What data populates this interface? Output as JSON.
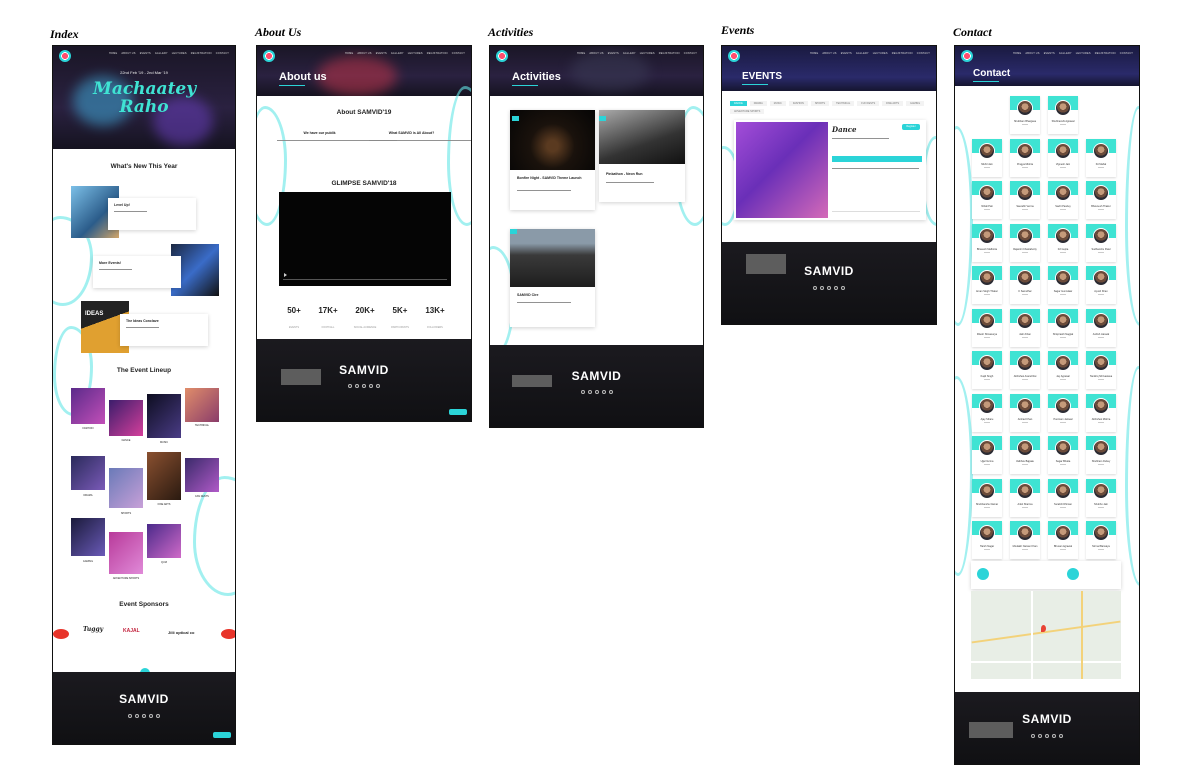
{
  "labels": {
    "index": "Index",
    "about": "About Us",
    "activities": "Activities",
    "events": "Events",
    "contact": "Contact"
  },
  "nav": [
    "HOME",
    "ABOUT US",
    "EVENTS",
    "GALLERY",
    "LECTURES",
    "REGISTRATION",
    "CONTACT"
  ],
  "index": {
    "hero_dates": "22nd Feb '19 - 2nd Mar '19",
    "hero_script": "Machaatey Raho",
    "whats_new": "What's New This Year",
    "new_items": [
      {
        "title": "Level Up!"
      },
      {
        "title": "More Events!"
      },
      {
        "title": "The Ideas Conclave"
      }
    ],
    "lineup_title": "The Event Lineup",
    "lineup": [
      {
        "label": "FASHION"
      },
      {
        "label": "DANCE"
      },
      {
        "label": "MUSIC"
      },
      {
        "label": "TECHNICAL"
      },
      {
        "label": "DRAMA"
      },
      {
        "label": "SPORTS"
      },
      {
        "label": "FINE ARTS"
      },
      {
        "label": "FAN FESTS"
      },
      {
        "label": "GAMING"
      },
      {
        "label": "ADVENTURE SPORTS"
      },
      {
        "label": "QUIZ"
      }
    ],
    "sponsors_title": "Event Sponsors",
    "sponsors": [
      "Tuggy",
      "KAJAL",
      "Jilli optical co"
    ],
    "footer_brand": "SAMVID"
  },
  "about": {
    "hero_title": "About us",
    "section_title": "About SAMVID'19",
    "col1_title": "We have our publik",
    "col2_title": "What SAMVID is All About?",
    "glimpse_title": "GLIMPSE SAMVID'18",
    "stats": [
      {
        "value": "50+",
        "label": "EVENTS"
      },
      {
        "value": "17K+",
        "label": "FOOTFALL"
      },
      {
        "value": "20K+",
        "label": "SOCIAL AUDIENCE"
      },
      {
        "value": "5K+",
        "label": "PARTICIPANTS"
      },
      {
        "value": "13K+",
        "label": "FOLLOWERS"
      }
    ],
    "footer_brand": "SAMVID"
  },
  "activities": {
    "hero_title": "Activities",
    "cards": [
      {
        "title": "Bonfire Night - SAMVID Theme Launch"
      },
      {
        "title": "Pinkathon - Neon Run"
      },
      {
        "title": "SAMVID Cire"
      }
    ],
    "footer_brand": "SAMVID"
  },
  "events": {
    "hero_title": "EVENTS",
    "tabs": [
      "DANCE",
      "DRAMA",
      "MUSIC",
      "FASHION",
      "SPORTS",
      "TECHNICAL",
      "FUN FESTS",
      "FINE ARTS",
      "GAMING",
      "ADVENTURE SPORTS"
    ],
    "event_name": "Dance",
    "register_label": "Register",
    "footer_brand": "SAMVID"
  },
  "contact": {
    "hero_title": "Contact",
    "team": [
      "Shubham Bhargava",
      "Shubhanshi Agrawal",
      "Nikhil Jain",
      "Pragya Mishra",
      "Vignesh Jain",
      "Kit Mahal",
      "Nihali Pati",
      "Saurabh Verma",
      "Sachi Pandey",
      "Bhavnesh Thakur",
      "Bhavesh Malhotra",
      "Rajarshi Chakraborty",
      "DJ Gupta",
      "Sudhanshu Patel",
      "Aman Singh Thakur",
      "K Sanndhar",
      "Sagar Gunndaar",
      "Ayush Khan",
      "Ritesh Shivasurya",
      "Jatin Khan",
      "Shivprasth Nagpal",
      "Ashish Jaiswal",
      "Kapil Singh",
      "Abhishek Anand Rai",
      "Jay Agrawal",
      "Tanishq Shrivastava",
      "Ajay Sihare",
      "Arshad Khan",
      "Poornam Jaiswal",
      "Abhishek Mishra",
      "Ujjal Verma",
      "Vaibhav Bajpaie",
      "Sagar Bhatia",
      "Shubham Dubey",
      "Shubhanshu Damar",
      "Ankit Sharma",
      "Surabhi Dhiman",
      "Shubho Jain",
      "Harsh Nagar",
      "Moulakh Naman Khan",
      "Bhuvan Agrawal",
      "Nirmal Barsaiya"
    ],
    "footer_brand": "SAMVID"
  }
}
